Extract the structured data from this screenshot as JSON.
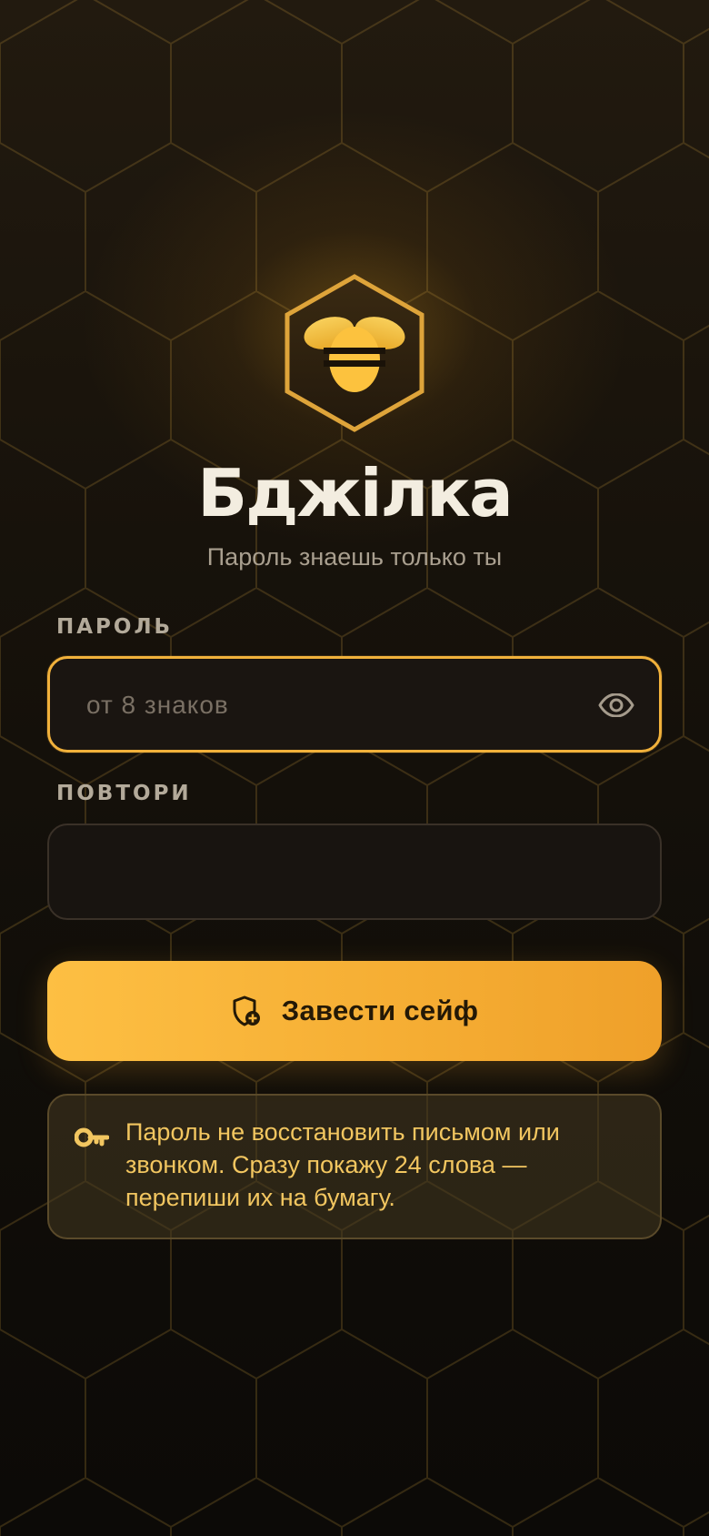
{
  "app": {
    "title": "Бджілка",
    "subtitle": "Пароль знаешь только ты",
    "logo_icon": "bee-hexagon-icon"
  },
  "form": {
    "password_label": "ПАРОЛЬ",
    "password_placeholder": "от 8 знаков",
    "password_value": "",
    "toggle_icon": "eye-icon",
    "repeat_label": "ПОВТОРИ",
    "repeat_placeholder": "",
    "repeat_value": ""
  },
  "actions": {
    "create_label": "Завести сейф",
    "create_icon": "shield-plus-icon"
  },
  "notice": {
    "icon": "key-icon",
    "text": "Пароль не восстановить письмом или звонком. Сразу покажу 24 слова — перепиши их на бумагу."
  },
  "colors": {
    "accent": "#f5ad33",
    "accent_text": "#f2c660",
    "background": "#15110b",
    "title": "#f3ede0"
  }
}
